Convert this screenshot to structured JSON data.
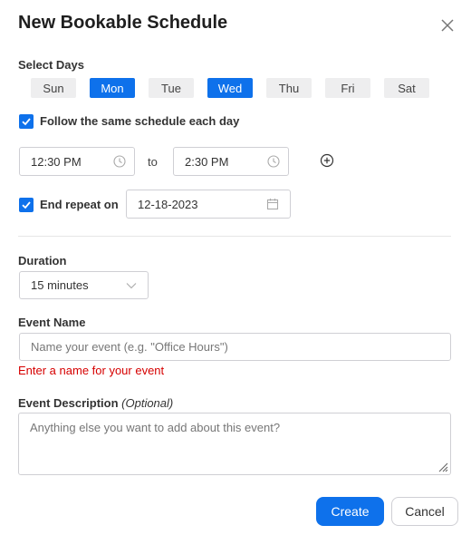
{
  "dialog": {
    "title": "New Bookable Schedule",
    "close_icon": "close-icon"
  },
  "select_days": {
    "label": "Select Days",
    "days": [
      {
        "label": "Sun",
        "selected": false
      },
      {
        "label": "Mon",
        "selected": true
      },
      {
        "label": "Tue",
        "selected": false
      },
      {
        "label": "Wed",
        "selected": true
      },
      {
        "label": "Thu",
        "selected": false
      },
      {
        "label": "Fri",
        "selected": false
      },
      {
        "label": "Sat",
        "selected": false
      }
    ]
  },
  "same_schedule": {
    "label": "Follow the same schedule each day",
    "checked": true
  },
  "time_range": {
    "start": "12:30 PM",
    "to_label": "to",
    "end": "2:30 PM",
    "add_icon": "add-circle-icon"
  },
  "end_repeat": {
    "label": "End repeat on",
    "checked": true,
    "date": "12-18-2023"
  },
  "duration": {
    "label": "Duration",
    "value": "15 minutes"
  },
  "event_name": {
    "label": "Event Name",
    "placeholder": "Name your event (e.g. \"Office Hours\")",
    "error": "Enter a name for your event"
  },
  "event_description": {
    "label": "Event Description",
    "optional": "(Optional)",
    "placeholder": "Anything else you want to add about this event?"
  },
  "buttons": {
    "create": "Create",
    "cancel": "Cancel"
  },
  "colors": {
    "accent": "#0e71eb",
    "error": "#d60000"
  }
}
